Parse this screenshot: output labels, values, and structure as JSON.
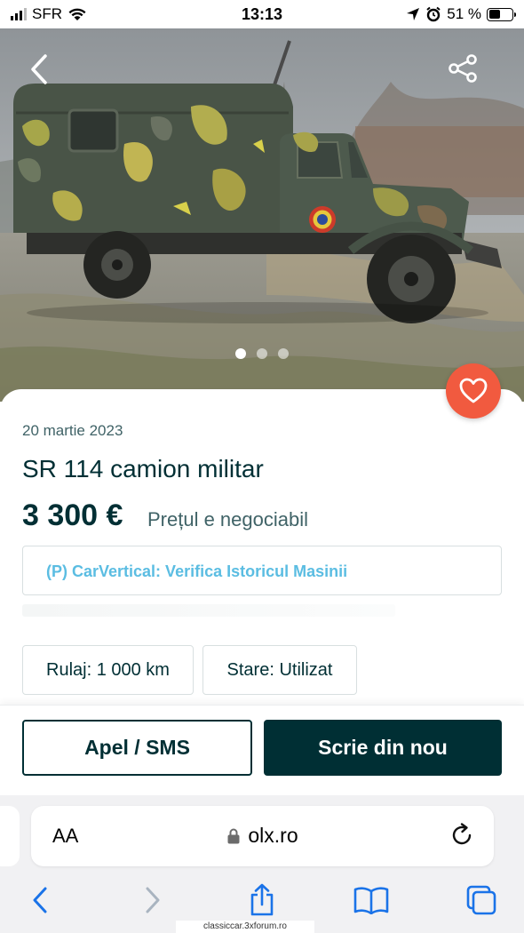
{
  "status_bar": {
    "carrier": "SFR",
    "time": "13:13",
    "battery_percent": "51 %",
    "battery_level": 0.51,
    "icons": [
      "signal-icon",
      "wifi-icon",
      "location-arrow-icon",
      "alarm-icon",
      "battery-icon"
    ]
  },
  "gallery": {
    "photo_count": 3,
    "active_index": 0,
    "icons": [
      "back-chevron-icon",
      "share-icon"
    ]
  },
  "listing": {
    "date": "20 martie 2023",
    "title": "SR 114 camion militar",
    "price": "3 300 €",
    "price_note": "Prețul e negociabil",
    "promo_link": "(P) CarVertical: Verifica Istoricul Masinii",
    "attributes": {
      "mileage": "Rulaj: 1 000 km",
      "condition": "Stare: Utilizat"
    },
    "favorite_icon": "heart-icon"
  },
  "actions": {
    "call_label": "Apel / SMS",
    "message_label": "Scrie din nou"
  },
  "browser": {
    "text_size_label": "AA",
    "url": "olx.ro",
    "icons": [
      "lock-icon",
      "reload-icon",
      "back-icon",
      "forward-icon",
      "share-icon",
      "bookmarks-icon",
      "tabs-icon"
    ]
  },
  "watermark": "classiccar.3xforum.ro",
  "colors": {
    "brand_dark": "#002f34",
    "favorite_accent": "#f15a3f",
    "link": "#5bbde2",
    "ios_blue": "#1a73e8"
  }
}
